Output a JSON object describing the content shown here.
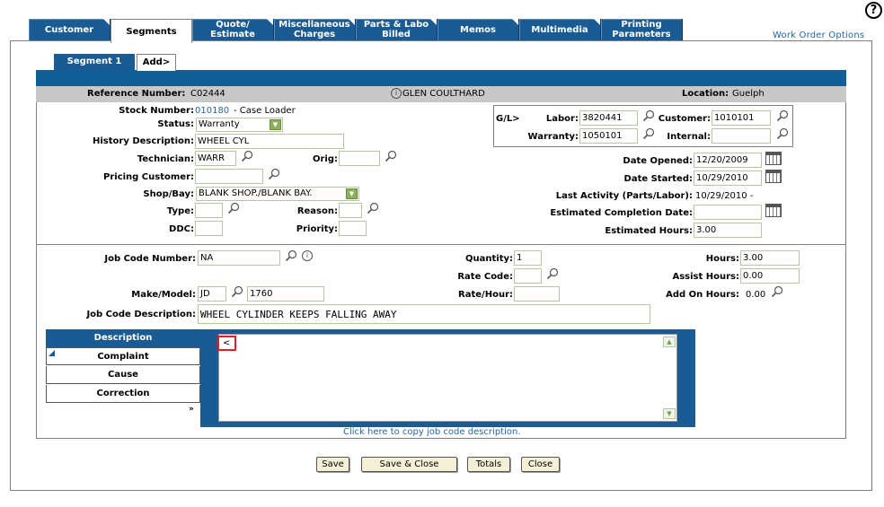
{
  "help": "?",
  "tabs": [
    {
      "label": "Customer"
    },
    {
      "label": "Segments"
    },
    {
      "label": "Quote/\nEstimate"
    },
    {
      "label": "Miscellaneous\nCharges"
    },
    {
      "label": "Parts & Labo\nBilled"
    },
    {
      "label": "Memos"
    },
    {
      "label": "Multimedia"
    },
    {
      "label": "Printing\nParameters"
    }
  ],
  "work_order_options": "Work Order Options",
  "segment_tabs": {
    "seg1": "Segment 1",
    "add": "Add>"
  },
  "header": {
    "reference_label": "Reference Number:",
    "reference_value": "C02444",
    "customer_name": "GLEN COULTHARD",
    "location_label": "Location:",
    "location_value": "Guelph"
  },
  "form": {
    "stock_label": "Stock Number:",
    "stock_value": "010180",
    "stock_desc": "- Case Loader",
    "status_label": "Status:",
    "status_value": "Warranty",
    "history_label": "History Description:",
    "history_value": "WHEEL CYL",
    "technician_label": "Technician:",
    "technician_value": "WARR",
    "orig_label": "Orig:",
    "orig_value": "",
    "pricing_label": "Pricing Customer:",
    "pricing_value": "",
    "shop_label": "Shop/Bay:",
    "shop_value": "BLANK SHOP./BLANK BAY.",
    "type_label": "Type:",
    "type_value": "",
    "reason_label": "Reason:",
    "reason_value": "",
    "ddc_label": "DDC:",
    "ddc_value": "",
    "priority_label": "Priority:",
    "priority_value": ""
  },
  "gl": {
    "title": "G/L>",
    "labor_label": "Labor:",
    "labor_value": "3820441",
    "customer_label": "Customer:",
    "customer_value": "1010101",
    "warranty_label": "Warranty:",
    "warranty_value": "1050101",
    "internal_label": "Internal:",
    "internal_value": ""
  },
  "dates": {
    "opened_label": "Date Opened:",
    "opened_value": "12/20/2009",
    "started_label": "Date Started:",
    "started_value": "10/29/2010",
    "activity_label": "Last Activity (Parts/Labor):",
    "activity_value": "10/29/2010  -",
    "est_completion_label": "Estimated Completion Date:",
    "est_completion_value": "",
    "est_hours_label": "Estimated Hours:",
    "est_hours_value": "3.00"
  },
  "job": {
    "code_label": "Job Code Number:",
    "code_value": "NA",
    "quantity_label": "Quantity:",
    "quantity_value": "1",
    "hours_label": "Hours:",
    "hours_value": "3.00",
    "rate_code_label": "Rate Code:",
    "rate_code_value": "",
    "assist_label": "Assist Hours:",
    "assist_value": "0.00",
    "make_label": "Make/Model:",
    "make_value": "JD",
    "model_value": "1760",
    "rate_hour_label": "Rate/Hour:",
    "rate_hour_value": "",
    "addon_label": "Add On Hours:",
    "addon_value": "0.00",
    "desc_label": "Job Code Description:",
    "desc_value": "WHEEL CYLINDER KEEPS FALLING AWAY"
  },
  "desc_tabs": {
    "description": "Description",
    "complaint": "Complaint",
    "cause": "Cause",
    "correction": "Correction",
    "more": "»"
  },
  "textarea_value": "<",
  "copy_link": "Click here to copy job code description.",
  "buttons": {
    "save": "Save",
    "save_close": "Save & Close",
    "totals": "Totals",
    "close": "Close"
  }
}
